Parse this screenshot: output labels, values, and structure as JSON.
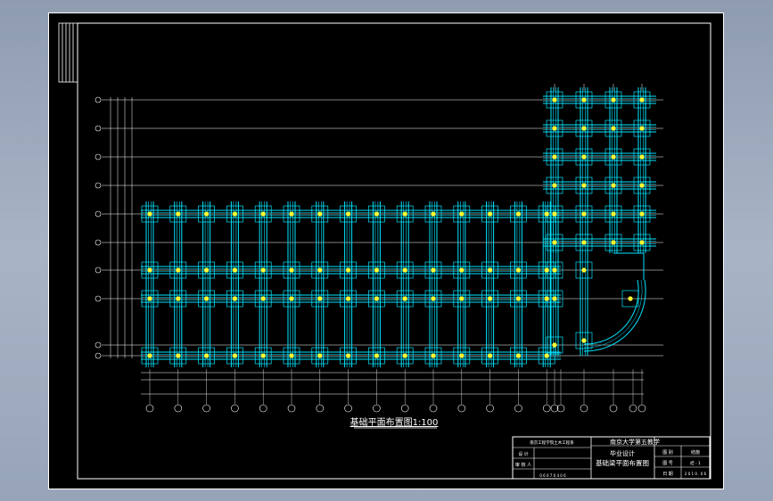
{
  "colors": {
    "background": "#000000",
    "frame": "#ffffff",
    "gridline": "#ffffff",
    "foundation": "#00e5ff",
    "column": "#ffff33",
    "dimension": "#ffffff"
  },
  "drawing_title": "基础平面布置图1:100",
  "title_block": {
    "school": "南京大学第五教学",
    "design_label": "毕业设计",
    "drawing_name": "基础梁平面布置图",
    "left_header": "南京工程学院土木工程系",
    "designer_label": "设 计",
    "reviewer_label": "审 核 人",
    "student_no": "0 6 0 7 0 4 0 6",
    "drawing_no_label": "图 别",
    "drawing_no_value": "结施",
    "sheet_label": "图 号",
    "sheet_value": "结 - 1",
    "date_label": "日 期",
    "date_value": "2 0 1 0 . 0 6"
  }
}
